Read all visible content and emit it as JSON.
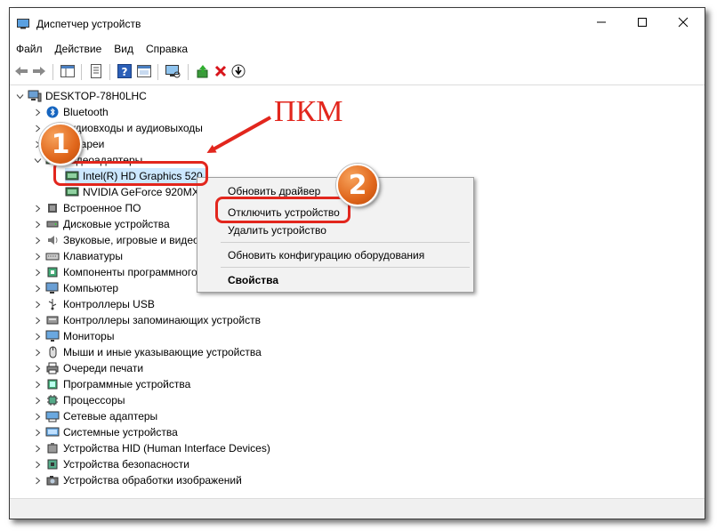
{
  "window": {
    "title": "Диспетчер устройств",
    "controls": {
      "minimize": "—",
      "maximize": "☐",
      "close": "✕"
    }
  },
  "menubar": [
    "Файл",
    "Действие",
    "Вид",
    "Справка"
  ],
  "tree": {
    "root": "DESKTOP-78H0LHC",
    "items": [
      {
        "label": "Bluetooth",
        "icon": "bluetooth-icon"
      },
      {
        "label": "Аудиовходы и аудиовыходы",
        "icon": "audio-io-icon"
      },
      {
        "label": "Батареи",
        "icon": "battery-icon"
      },
      {
        "label": "Видеоадаптеры",
        "icon": "display-adapter-icon",
        "expanded": true,
        "children": [
          "Intel(R) HD Graphics 520",
          "NVIDIA GeForce 920MX"
        ]
      },
      {
        "label": "Встроенное ПО",
        "icon": "firmware-icon"
      },
      {
        "label": "Дисковые устройства",
        "icon": "disk-icon"
      },
      {
        "label": "Звуковые, игровые и видеоустройства",
        "icon": "sound-icon"
      },
      {
        "label": "Клавиатуры",
        "icon": "keyboard-icon"
      },
      {
        "label": "Компоненты программного обеспечения",
        "icon": "software-component-icon"
      },
      {
        "label": "Компьютер",
        "icon": "computer-icon"
      },
      {
        "label": "Контроллеры USB",
        "icon": "usb-icon"
      },
      {
        "label": "Контроллеры запоминающих устройств",
        "icon": "storage-controller-icon"
      },
      {
        "label": "Мониторы",
        "icon": "monitor-icon"
      },
      {
        "label": "Мыши и иные указывающие устройства",
        "icon": "mouse-icon"
      },
      {
        "label": "Очереди печати",
        "icon": "printer-icon"
      },
      {
        "label": "Программные устройства",
        "icon": "software-device-icon"
      },
      {
        "label": "Процессоры",
        "icon": "processor-icon"
      },
      {
        "label": "Сетевые адаптеры",
        "icon": "network-adapter-icon"
      },
      {
        "label": "Системные устройства",
        "icon": "system-device-icon"
      },
      {
        "label": "Устройства HID (Human Interface Devices)",
        "icon": "hid-icon"
      },
      {
        "label": "Устройства безопасности",
        "icon": "security-device-icon"
      },
      {
        "label": "Устройства обработки изображений",
        "icon": "imaging-device-icon"
      }
    ]
  },
  "context_menu": {
    "update_driver": "Обновить драйвер",
    "disable_device": "Отключить устройство",
    "uninstall_device": "Удалить устройство",
    "scan_hardware": "Обновить конфигурацию оборудования",
    "properties": "Свойства"
  },
  "annotations": {
    "pkm_label": "ПКМ",
    "step1": "1",
    "step2": "2",
    "accent_color": "#e2261d",
    "badge_color": "#e0661b"
  }
}
